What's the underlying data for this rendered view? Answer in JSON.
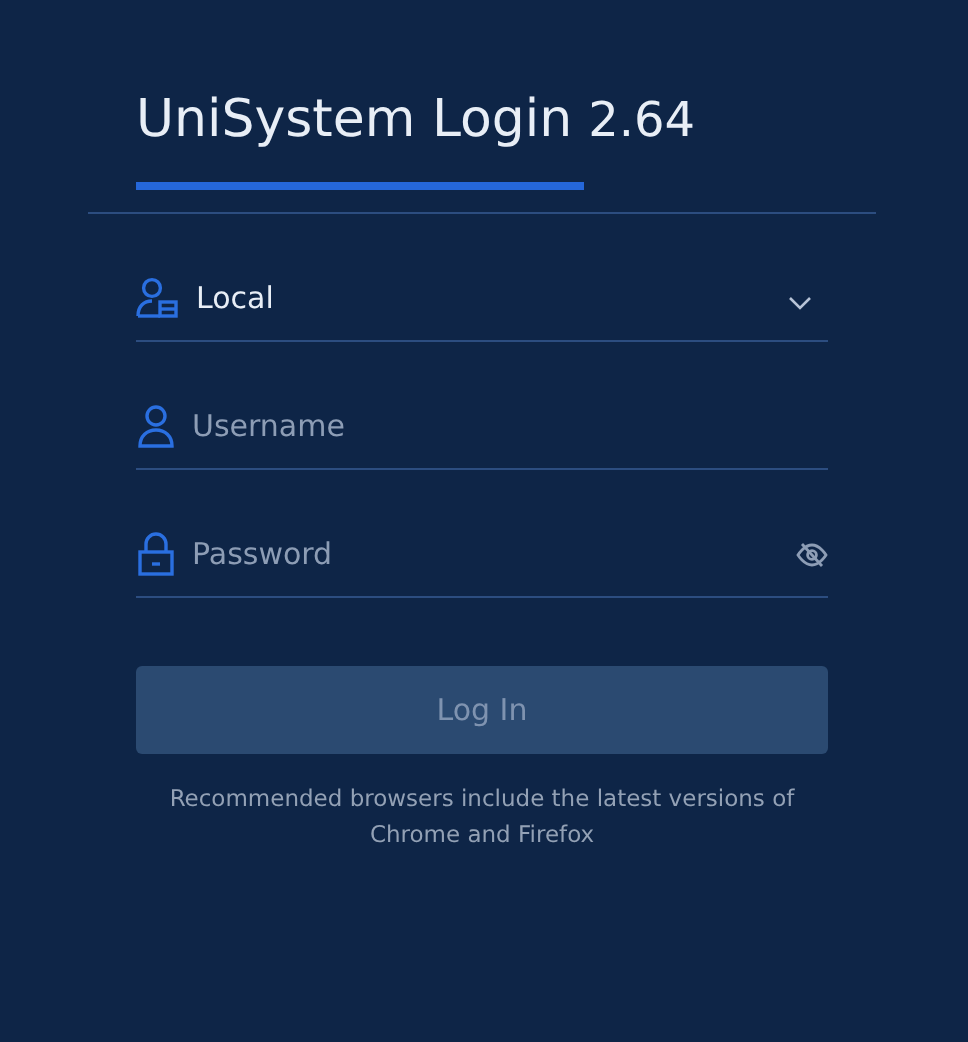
{
  "header": {
    "title": "UniSystem Login",
    "version": "2.64"
  },
  "tabs": [
    {
      "selected": true
    }
  ],
  "fields": [
    {
      "kind": "select",
      "value": "Local"
    },
    {
      "kind": "text",
      "placeholder": "Username"
    },
    {
      "kind": "password",
      "placeholder": "Password",
      "revealed": false
    }
  ],
  "login_button": {
    "label": "Log In",
    "disabled": true
  },
  "note": "Recommended browsers include the latest versions of Chrome and Firefox"
}
